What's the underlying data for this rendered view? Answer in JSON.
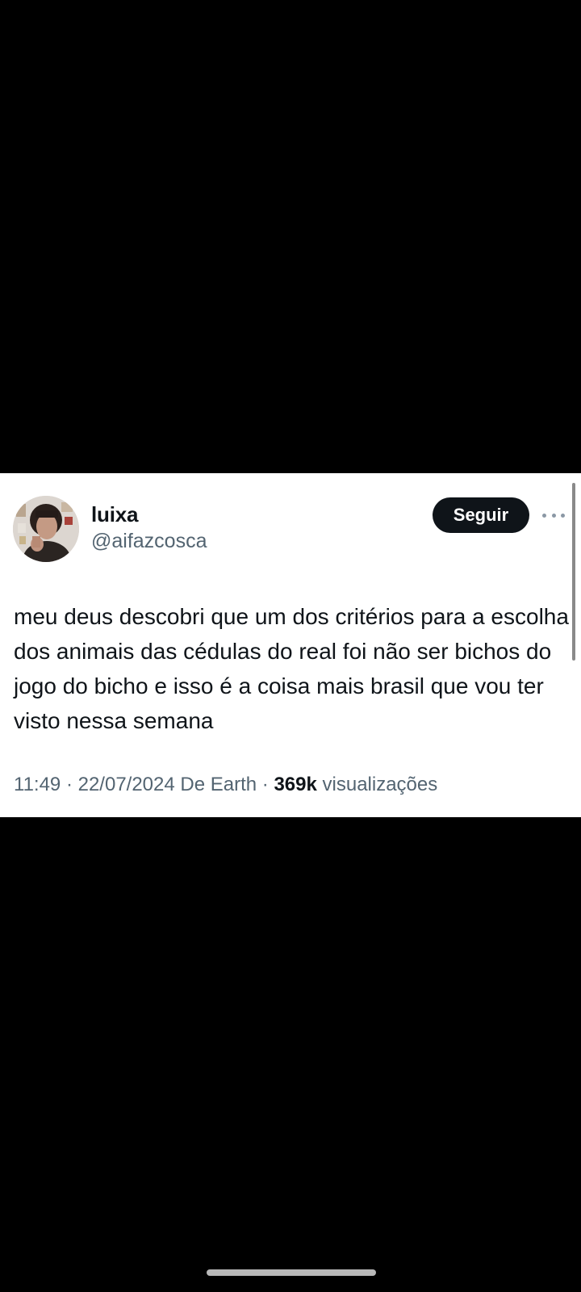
{
  "tweet": {
    "display_name": "luixa",
    "handle": "@aifazcosca",
    "follow_label": "Seguir",
    "text": "meu deus descobri que um dos critérios para a escolha dos animais das cédulas do real foi não ser bichos do jogo do bicho e isso é a coisa mais brasil que vou ter visto nessa semana",
    "time": "11:49",
    "date": "22/07/2024",
    "source": "De Earth",
    "separator": " · ",
    "views_count": "369k",
    "views_label": "visualizações"
  },
  "icons": {
    "more": "more-horizontal-icon",
    "avatar": "profile-photo"
  },
  "colors": {
    "background": "#000000",
    "card": "#ffffff",
    "primary_text": "#0f1419",
    "secondary_text": "#536471",
    "follow_button": "#0f1419"
  }
}
